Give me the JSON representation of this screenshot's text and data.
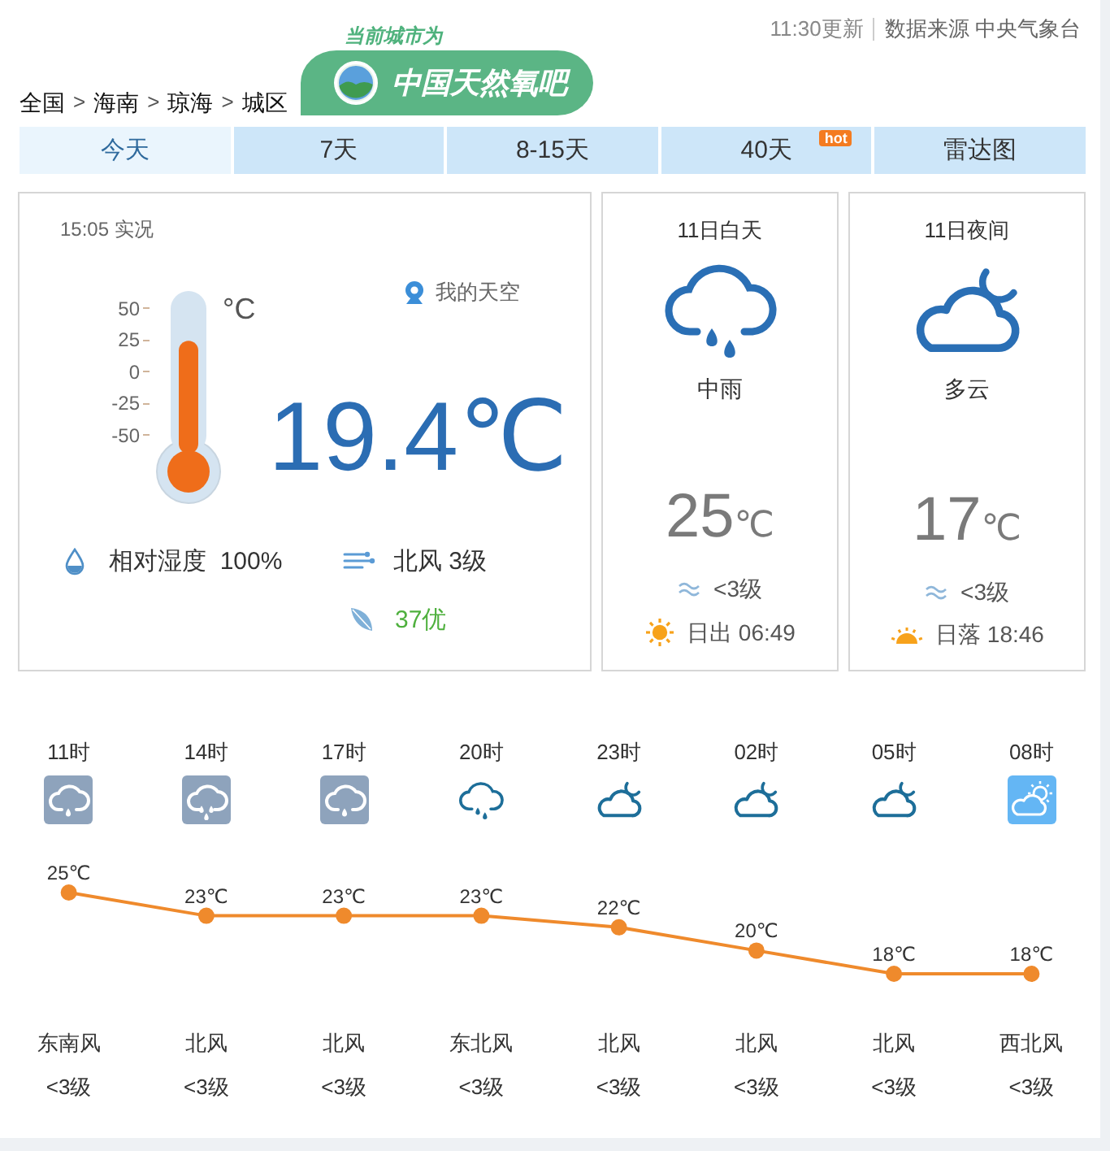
{
  "header": {
    "city_caption": "当前城市为",
    "city_badge": "中国天然氧吧",
    "update_time": "11:30更新",
    "source": "数据来源 中央气象台"
  },
  "breadcrumb": [
    {
      "kind": "link",
      "text": "全国"
    },
    {
      "kind": "separator",
      "text": ">"
    },
    {
      "kind": "link",
      "text": "海南"
    },
    {
      "kind": "separator",
      "text": ">"
    },
    {
      "kind": "link",
      "text": "琼海"
    },
    {
      "kind": "separator",
      "text": ">"
    },
    {
      "kind": "link",
      "text": "城区"
    }
  ],
  "tabs": [
    {
      "label": "今天",
      "selected": true
    },
    {
      "label": "7天",
      "selected": false
    },
    {
      "label": "8-15天",
      "selected": false
    },
    {
      "label": "40天",
      "selected": false,
      "badge": "hot"
    },
    {
      "label": "雷达图",
      "selected": false
    }
  ],
  "current": {
    "observed": "15:05 实况",
    "sky_link": "我的天空",
    "thermometer": {
      "scale": [
        "50",
        "25",
        "0",
        "-25",
        "-50"
      ],
      "unit": "°C",
      "level": 0.694
    },
    "temperature": "19.4℃",
    "humidity": "相对湿度  100%",
    "wind": "北风 3级",
    "aqi": "37优"
  },
  "periods": [
    {
      "title": "11日白天",
      "kind": "rain",
      "weather": "中雨",
      "temp": "25",
      "unit": "℃",
      "wind": "<3级",
      "sun": {
        "kind": "sunrise",
        "text": "日出 06:49"
      }
    },
    {
      "title": "11日夜间",
      "kind": "cloud-moon",
      "weather": "多云",
      "temp": "17",
      "unit": "℃",
      "wind": "<3级",
      "sun": {
        "kind": "sunset",
        "text": "日落 18:46"
      }
    }
  ],
  "hourly": {
    "items": [
      {
        "time": "11时",
        "kind": "light-rain-tile",
        "wind_direction": "东南风",
        "wind_level": "<3级"
      },
      {
        "time": "14时",
        "kind": "moderate-rain-tile",
        "wind_direction": "北风",
        "wind_level": "<3级"
      },
      {
        "time": "17时",
        "kind": "light-rain-tile",
        "wind_direction": "北风",
        "wind_level": "<3级"
      },
      {
        "time": "20时",
        "kind": "light-rain",
        "wind_direction": "东北风",
        "wind_level": "<3级"
      },
      {
        "time": "23时",
        "kind": "cloud-moon",
        "wind_direction": "北风",
        "wind_level": "<3级"
      },
      {
        "time": "02时",
        "kind": "cloud-moon",
        "wind_direction": "北风",
        "wind_level": "<3级"
      },
      {
        "time": "05时",
        "kind": "cloud-moon",
        "wind_direction": "北风",
        "wind_level": "<3级"
      },
      {
        "time": "08时",
        "kind": "cloud-sun-tile",
        "wind_direction": "西北风",
        "wind_level": "<3级"
      }
    ],
    "chart_data": {
      "type": "line",
      "series": [
        {
          "color": "#ef8a2c",
          "marker": true,
          "values": [
            25,
            23,
            23,
            23,
            22,
            20,
            18,
            18
          ],
          "value_labels": [
            "25℃",
            "23℃",
            "23℃",
            "23℃",
            "22℃",
            "20℃",
            "18℃",
            "18℃"
          ]
        }
      ]
    }
  }
}
